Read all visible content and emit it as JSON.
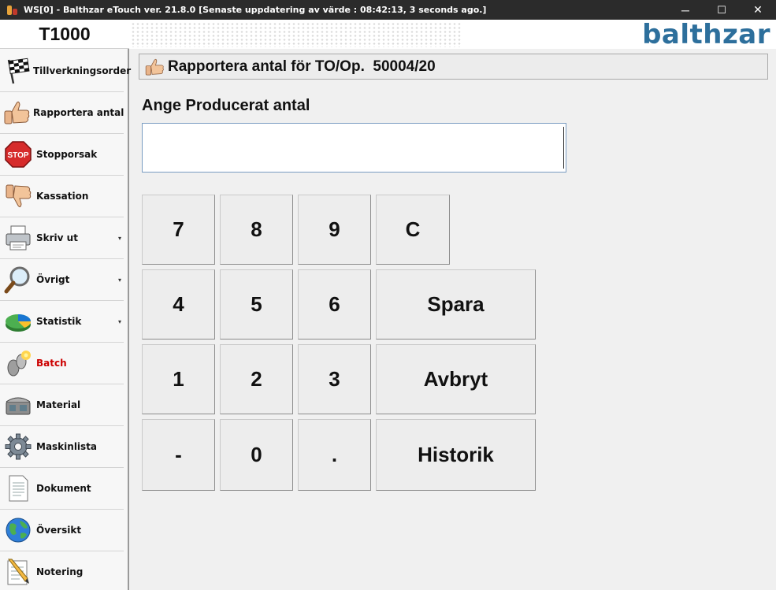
{
  "window": {
    "title": "WS[0] - Balthzar eTouch ver. 21.8.0  [Senaste uppdatering av värde : 08:42:13, 3 seconds ago.]",
    "minimize": "─",
    "maximize": "☐",
    "close": "✕"
  },
  "header": {
    "machine": "T1000",
    "logo": "balthzar"
  },
  "sidebar": {
    "items": [
      {
        "label": "Tillverkningsorder",
        "icon": "checkered-flag-icon"
      },
      {
        "label": "Rapportera antal",
        "icon": "thumbs-up-icon"
      },
      {
        "label": "Stopporsak",
        "icon": "stop-sign-icon",
        "icon_text": "STOP"
      },
      {
        "label": "Kassation",
        "icon": "thumbs-down-icon"
      },
      {
        "label": "Skriv ut",
        "icon": "printer-icon",
        "caret": "▾"
      },
      {
        "label": "Övrigt",
        "icon": "magnifier-icon",
        "caret": "▾"
      },
      {
        "label": "Statistik",
        "icon": "pie-chart-icon",
        "caret": "▾"
      },
      {
        "label": "Batch",
        "icon": "batch-footprint-icon",
        "highlight_color": "#cc0000"
      },
      {
        "label": "Material",
        "icon": "material-box-icon"
      },
      {
        "label": "Maskinlista",
        "icon": "gear-icon"
      },
      {
        "label": "Dokument",
        "icon": "document-icon"
      },
      {
        "label": "Översikt",
        "icon": "globe-icon"
      },
      {
        "label": "Notering",
        "icon": "note-pencil-icon"
      }
    ]
  },
  "main": {
    "operation_title": "Rapportera antal för TO/Op.  50004/20",
    "prompt": "Ange Producerat antal",
    "input_value": "",
    "keys": {
      "k7": "7",
      "k8": "8",
      "k9": "9",
      "clear": "C",
      "k4": "4",
      "k5": "5",
      "k6": "6",
      "save": "Spara",
      "k1": "1",
      "k2": "2",
      "k3": "3",
      "cancel": "Avbryt",
      "minus": "-",
      "k0": "0",
      "dot": ".",
      "history": "Historik"
    }
  },
  "colors": {
    "title_bar": "#2b2b2b",
    "logo": "#2d6f9c",
    "batch_label": "#cc0000"
  }
}
